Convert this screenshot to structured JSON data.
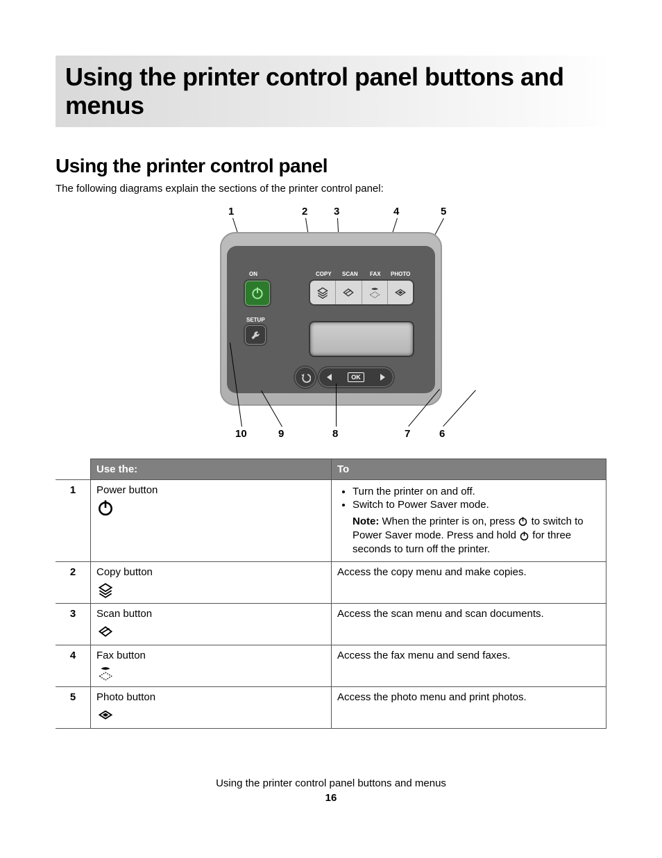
{
  "heading": "Using the printer control panel buttons and menus",
  "subheading": "Using the printer control panel",
  "intro": "The following diagrams explain the sections of the printer control panel:",
  "diagram": {
    "callouts_top": {
      "c1": "1",
      "c2": "2",
      "c3": "3",
      "c4": "4",
      "c5": "5"
    },
    "callouts_bottom": {
      "c10": "10",
      "c9": "9",
      "c8": "8",
      "c7": "7",
      "c6": "6"
    },
    "labels": {
      "on": "ON",
      "setup": "SETUP",
      "copy": "COPY",
      "scan": "SCAN",
      "fax": "FAX",
      "photo": "PHOTO",
      "ok": "OK"
    }
  },
  "table": {
    "headers": {
      "use": "Use the:",
      "to": "To"
    },
    "rows": [
      {
        "num": "1",
        "name": "Power button",
        "icon": "power-icon",
        "to_bullets": [
          "Turn the printer on and off.",
          "Switch to Power Saver mode."
        ],
        "note_prefix": "Note:",
        "note_a": " When the printer is on, press ",
        "note_b": " to switch to Power Saver mode. Press and hold ",
        "note_c": " for three seconds to turn off the printer."
      },
      {
        "num": "2",
        "name": "Copy button",
        "icon": "copy-icon",
        "to": "Access the copy menu and make copies."
      },
      {
        "num": "3",
        "name": "Scan button",
        "icon": "scan-icon",
        "to": "Access the scan menu and scan documents."
      },
      {
        "num": "4",
        "name": "Fax button",
        "icon": "fax-icon",
        "to": "Access the fax menu and send faxes."
      },
      {
        "num": "5",
        "name": "Photo button",
        "icon": "photo-icon",
        "to": "Access the photo menu and print photos."
      }
    ]
  },
  "footer": {
    "title": "Using the printer control panel buttons and menus",
    "page": "16"
  }
}
